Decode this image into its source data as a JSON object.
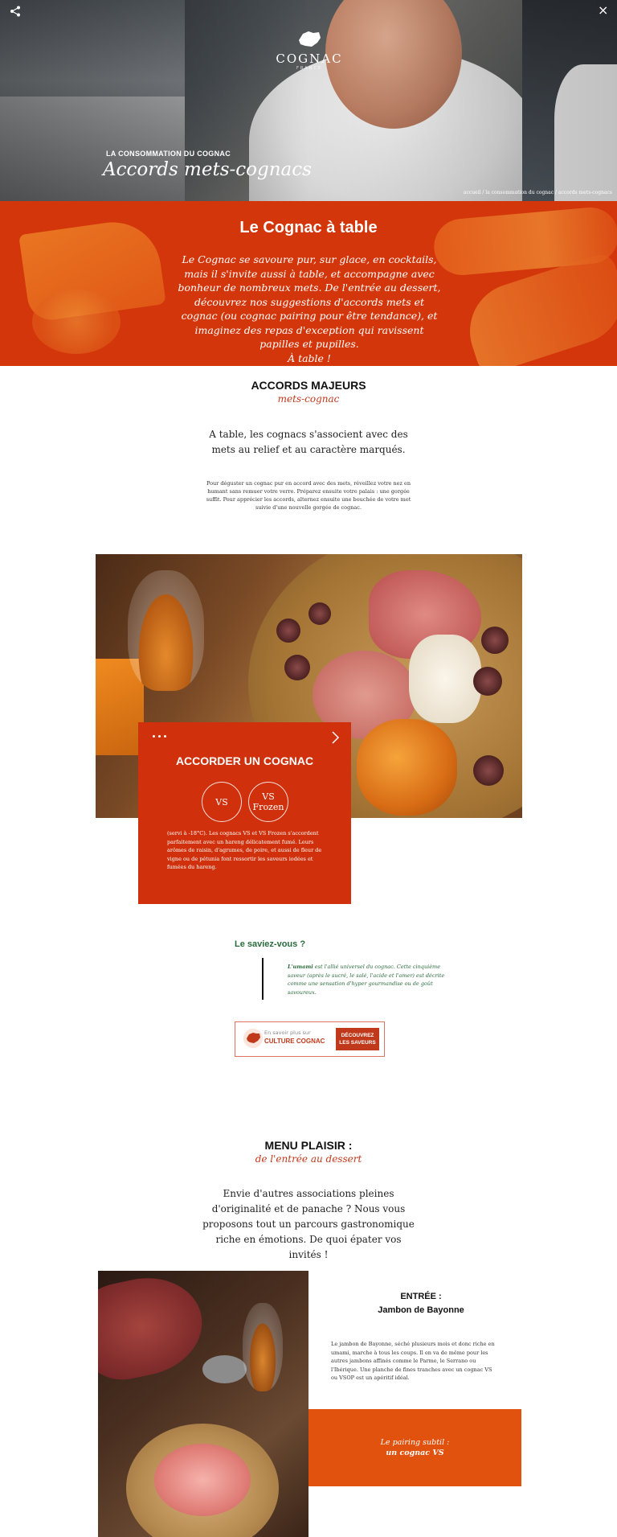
{
  "hero": {
    "logo_word": "COGNAC",
    "logo_sub": "FRANCE",
    "kicker": "LA CONSOMMATION DU COGNAC",
    "title": "Accords mets-cognacs",
    "breadcrumb": "accueil / la consommation du cognac / accords mets-cognacs",
    "close": "×"
  },
  "intro": {
    "title": "Le Cognac à table",
    "text": "Le Cognac se savoure pur, sur glace, en cocktails, mais il s'invite aussi à table, et accompagne avec bonheur de nombreux mets. De l'entrée au dessert, découvrez nos suggestions d'accords mets et cognac (ou cognac pairing pour être tendance), et imaginez des repas d'exception qui ravissent papilles et pupilles.",
    "closing": "À table !"
  },
  "majeurs": {
    "title": "ACCORDS MAJEURS",
    "subtitle": "mets-cognac",
    "lead": "A table, les cognacs s'associent avec des mets au relief et au caractère marqués.",
    "detail": "Pour déguster un cognac pur en accord avec des mets, réveillez votre nez en humant sans remuer votre verre. Préparez ensuite votre palais : une gorgée suffit. Pour apprécier les accords, alternez ensuite une bouchée de votre met suivie d'une nouvelle gorgée de cognac."
  },
  "pairing_card": {
    "title": "ACCORDER UN COGNAC",
    "option_vs": "VS",
    "option_vs_frozen": "VS Frozen",
    "text": "(servi à -18°C). Les cognacs VS et VS Frozen s'accordent parfaitement avec un hareng délicatement fumé. Leurs arômes de raisin, d'agrumes, de poire, et aussi de fleur de vigne ou de pétunia font ressortir les saveurs iodées et fumées du hareng."
  },
  "saviez_vous": {
    "title": "Le saviez-vous ?",
    "term": "L'umami",
    "text": " est l'allié universel du cognac. Cette cinquième saveur (après le sucré, le salé, l'acide et l'amer) est décrite comme une sensation d'hyper gourmandise ou de goût savoureux."
  },
  "culture_cta": {
    "line1": "En savoir plus sur",
    "line2": "CULTURE COGNAC",
    "button": "DÉCOUVREZ LES SAVEURS"
  },
  "menu": {
    "title": "MENU PLAISIR :",
    "subtitle": "de l'entrée au dessert",
    "lead": "Envie d'autres associations pleines d'originalité et de panache ? Nous vous proposons tout un parcours gastronomique riche en émotions. De quoi épater vos invités !"
  },
  "entree": {
    "kicker": "ENTRÉE :",
    "name": "Jambon de Bayonne",
    "text": "Le jambon de Bayonne, séché plusieurs mois et donc riche en umami, marche à tous les coups. Il en va de même pour les autres jambons affinés comme le Parme, le Serrano ou l'Ibérique. Une planche de fines tranches avec un cognac VS ou VSOP est un apéritif idéal.",
    "pairing_label": "Le pairing subtil :",
    "pairing_value": "un cognac VS"
  },
  "colors": {
    "accent": "#d0310c",
    "green": "#2a6b3c",
    "orange": "#e2520f"
  }
}
